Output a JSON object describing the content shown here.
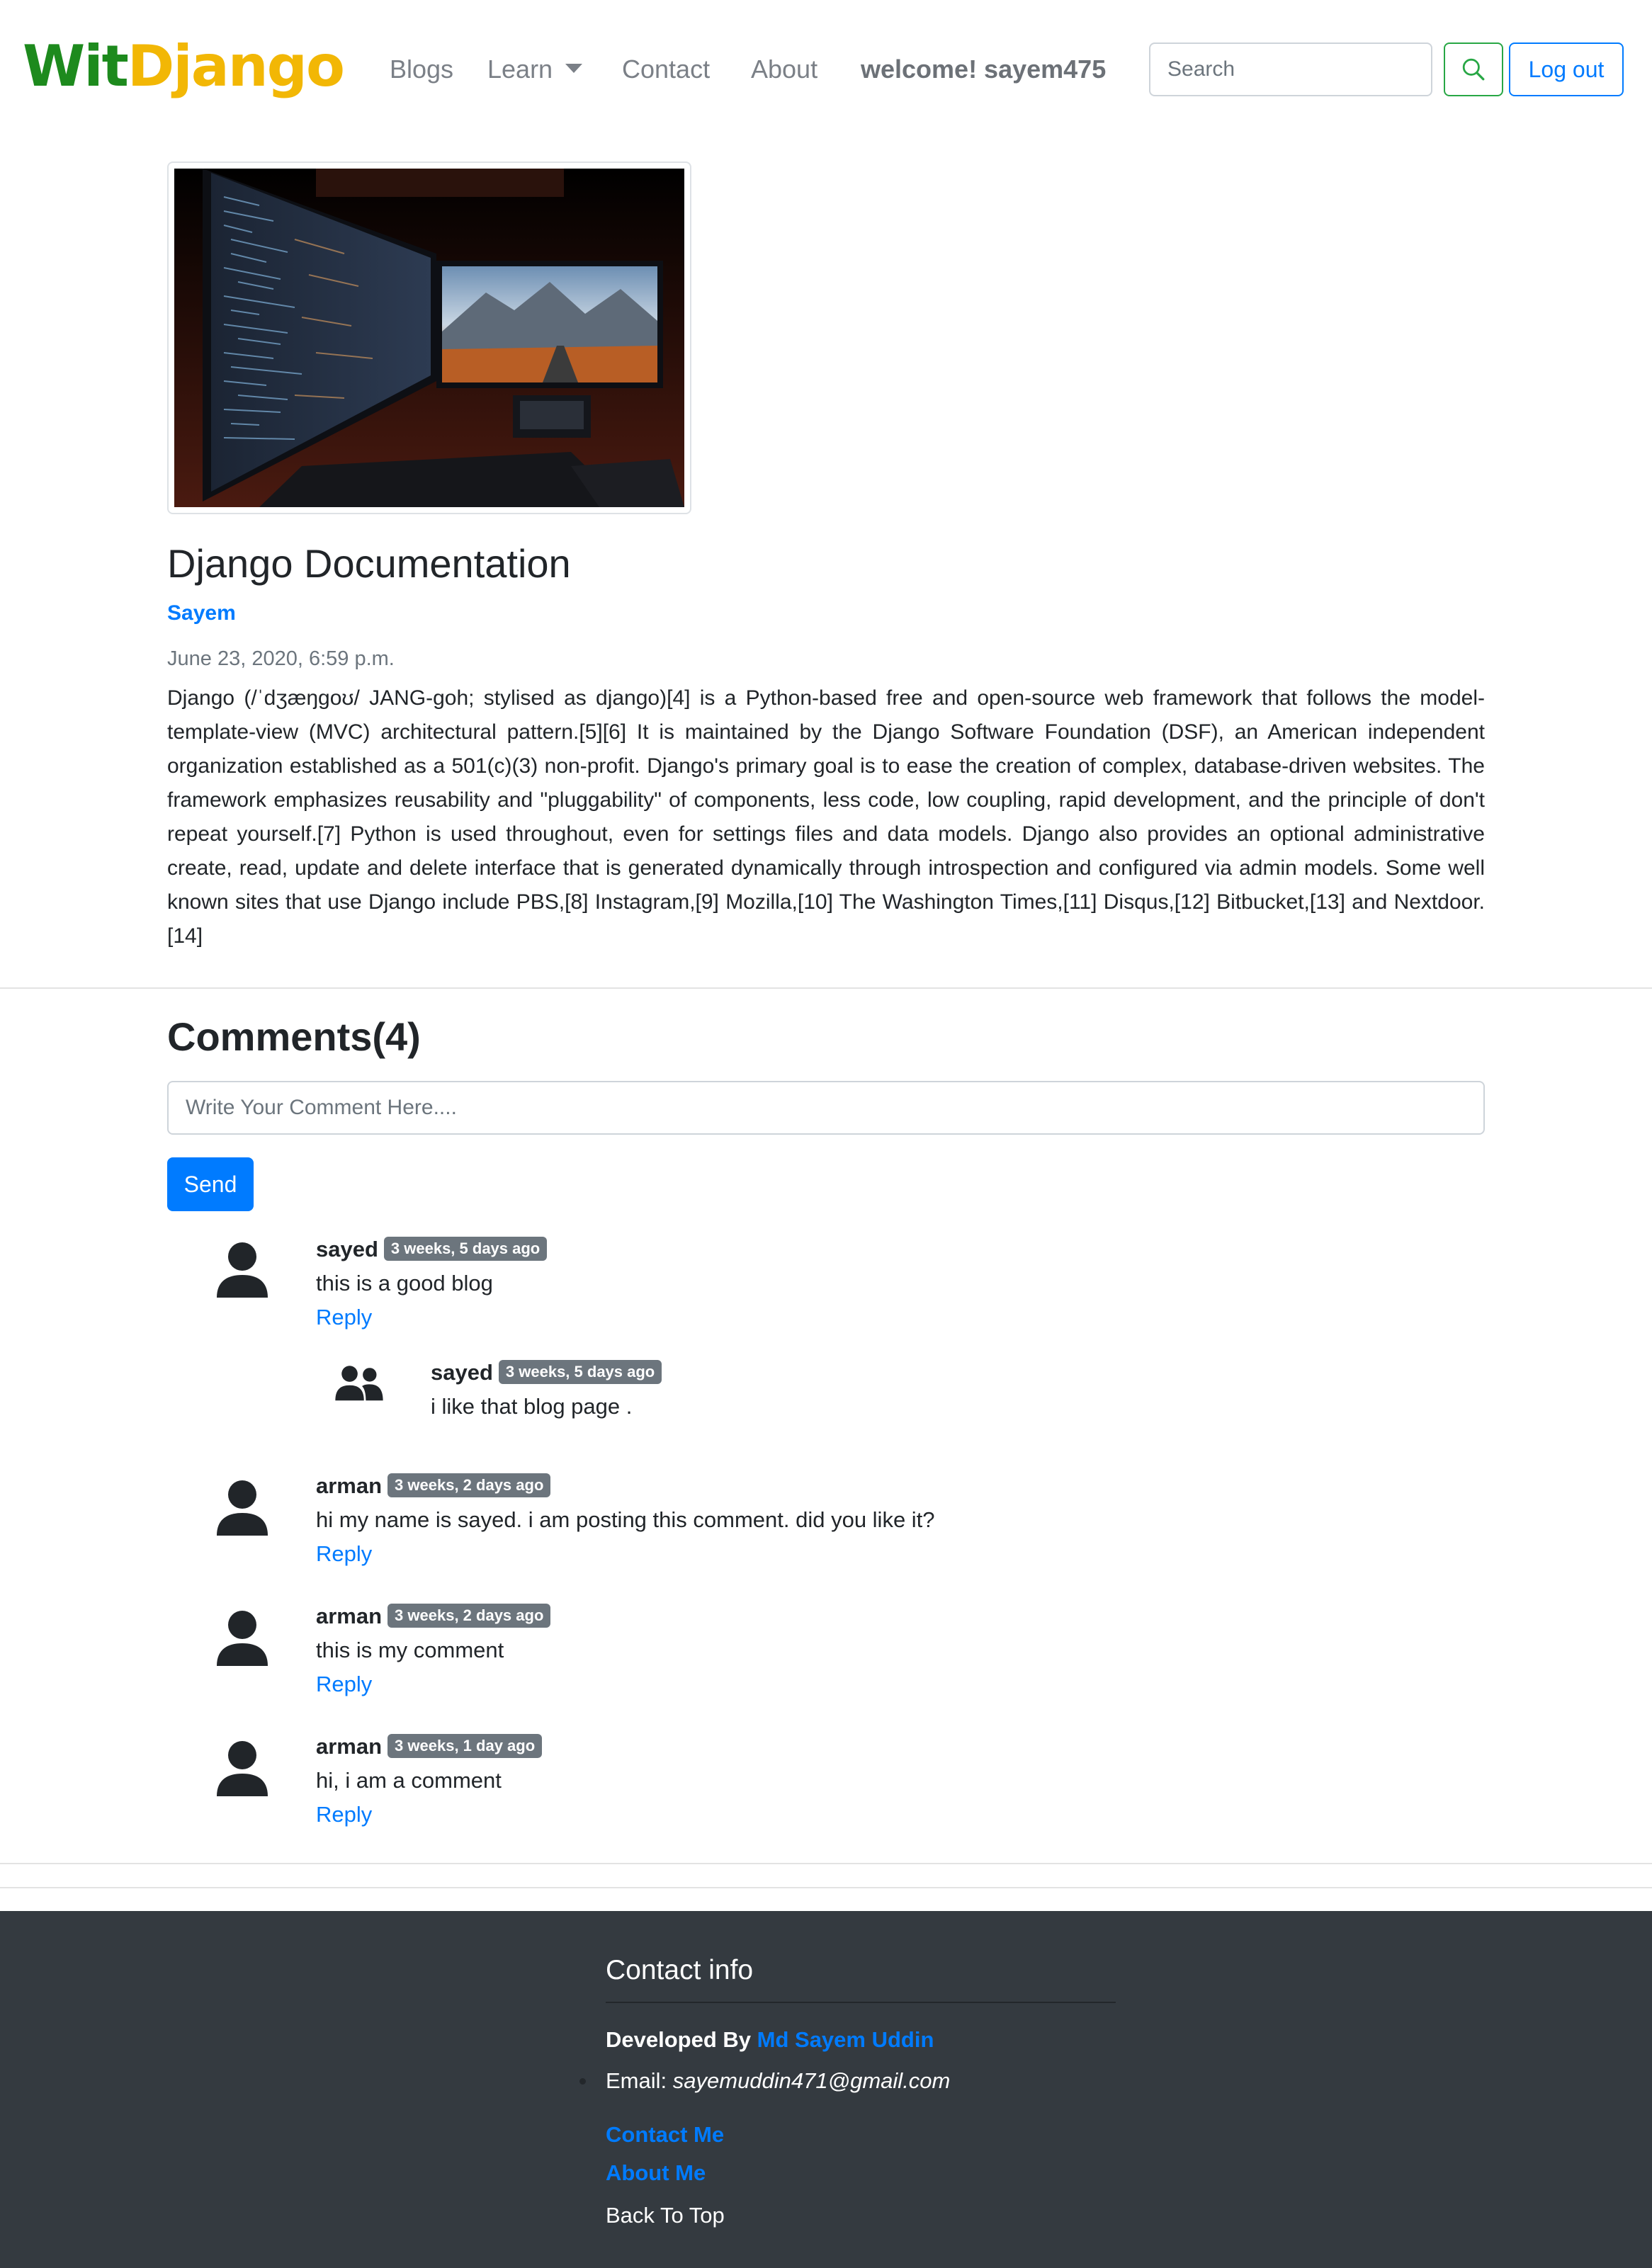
{
  "nav": {
    "brand_part1": "Wit",
    "brand_part2": "Django",
    "links": [
      "Blogs",
      "Learn",
      "Contact",
      "About"
    ],
    "welcome": "welcome! sayem475",
    "search_placeholder": "Search",
    "logout_label": "Log out"
  },
  "post": {
    "title": "Django Documentation",
    "author": "Sayem",
    "date": "June 23, 2020, 6:59 p.m.",
    "body": "Django (/ˈdʒæŋɡoʊ/ JANG-goh; stylised as django)[4] is a Python-based free and open-source web framework that follows the model-template-view (MVC) architectural pattern.[5][6] It is maintained by the Django Software Foundation (DSF), an American independent organization established as a 501(c)(3) non-profit. Django's primary goal is to ease the creation of complex, database-driven websites. The framework emphasizes reusability and \"pluggability\" of components, less code, low coupling, rapid development, and the principle of don't repeat yourself.[7] Python is used throughout, even for settings files and data models. Django also provides an optional administrative create, read, update and delete interface that is generated dynamically through introspection and configured via admin models. Some well known sites that use Django include PBS,[8] Instagram,[9] Mozilla,[10] The Washington Times,[11] Disqus,[12] Bitbucket,[13] and Nextdoor.[14]"
  },
  "comments": {
    "heading": "Comments",
    "count": "(4)",
    "input_placeholder": "Write Your Comment Here....",
    "send_label": "Send",
    "reply_label": "Reply",
    "items": [
      {
        "user": "sayed",
        "time": "3 weeks, 5 days ago",
        "text": "this is a good blog"
      },
      {
        "user": "sayed",
        "time": "3 weeks, 5 days ago",
        "text": "i like that blog page ."
      },
      {
        "user": "arman",
        "time": "3 weeks, 2 days ago",
        "text": "hi my name is sayed. i am posting this comment. did you like it?"
      },
      {
        "user": "arman",
        "time": "3 weeks, 2 days ago",
        "text": "this is my comment"
      },
      {
        "user": "arman",
        "time": "3 weeks, 1 day ago",
        "text": "hi, i am a comment"
      }
    ]
  },
  "footer": {
    "title": "Contact info",
    "developed_by": "Developed By",
    "developer_name": "Md Sayem Uddin",
    "email_label": "Email:",
    "email": "sayemuddin471@gmail.com",
    "contact_link": "Contact Me",
    "about_link": "About Me",
    "back_to_top": "Back To Top"
  },
  "colors": {
    "brand_green": "#1d8a1d",
    "brand_yellow": "#f2b705",
    "primary": "#007bff",
    "success": "#28a745",
    "badge": "#6c757d",
    "footer_bg": "#343a40"
  },
  "icons": {
    "search": "search-icon",
    "user": "user-icon",
    "users": "users-icon",
    "caret": "chevron-down-icon"
  }
}
